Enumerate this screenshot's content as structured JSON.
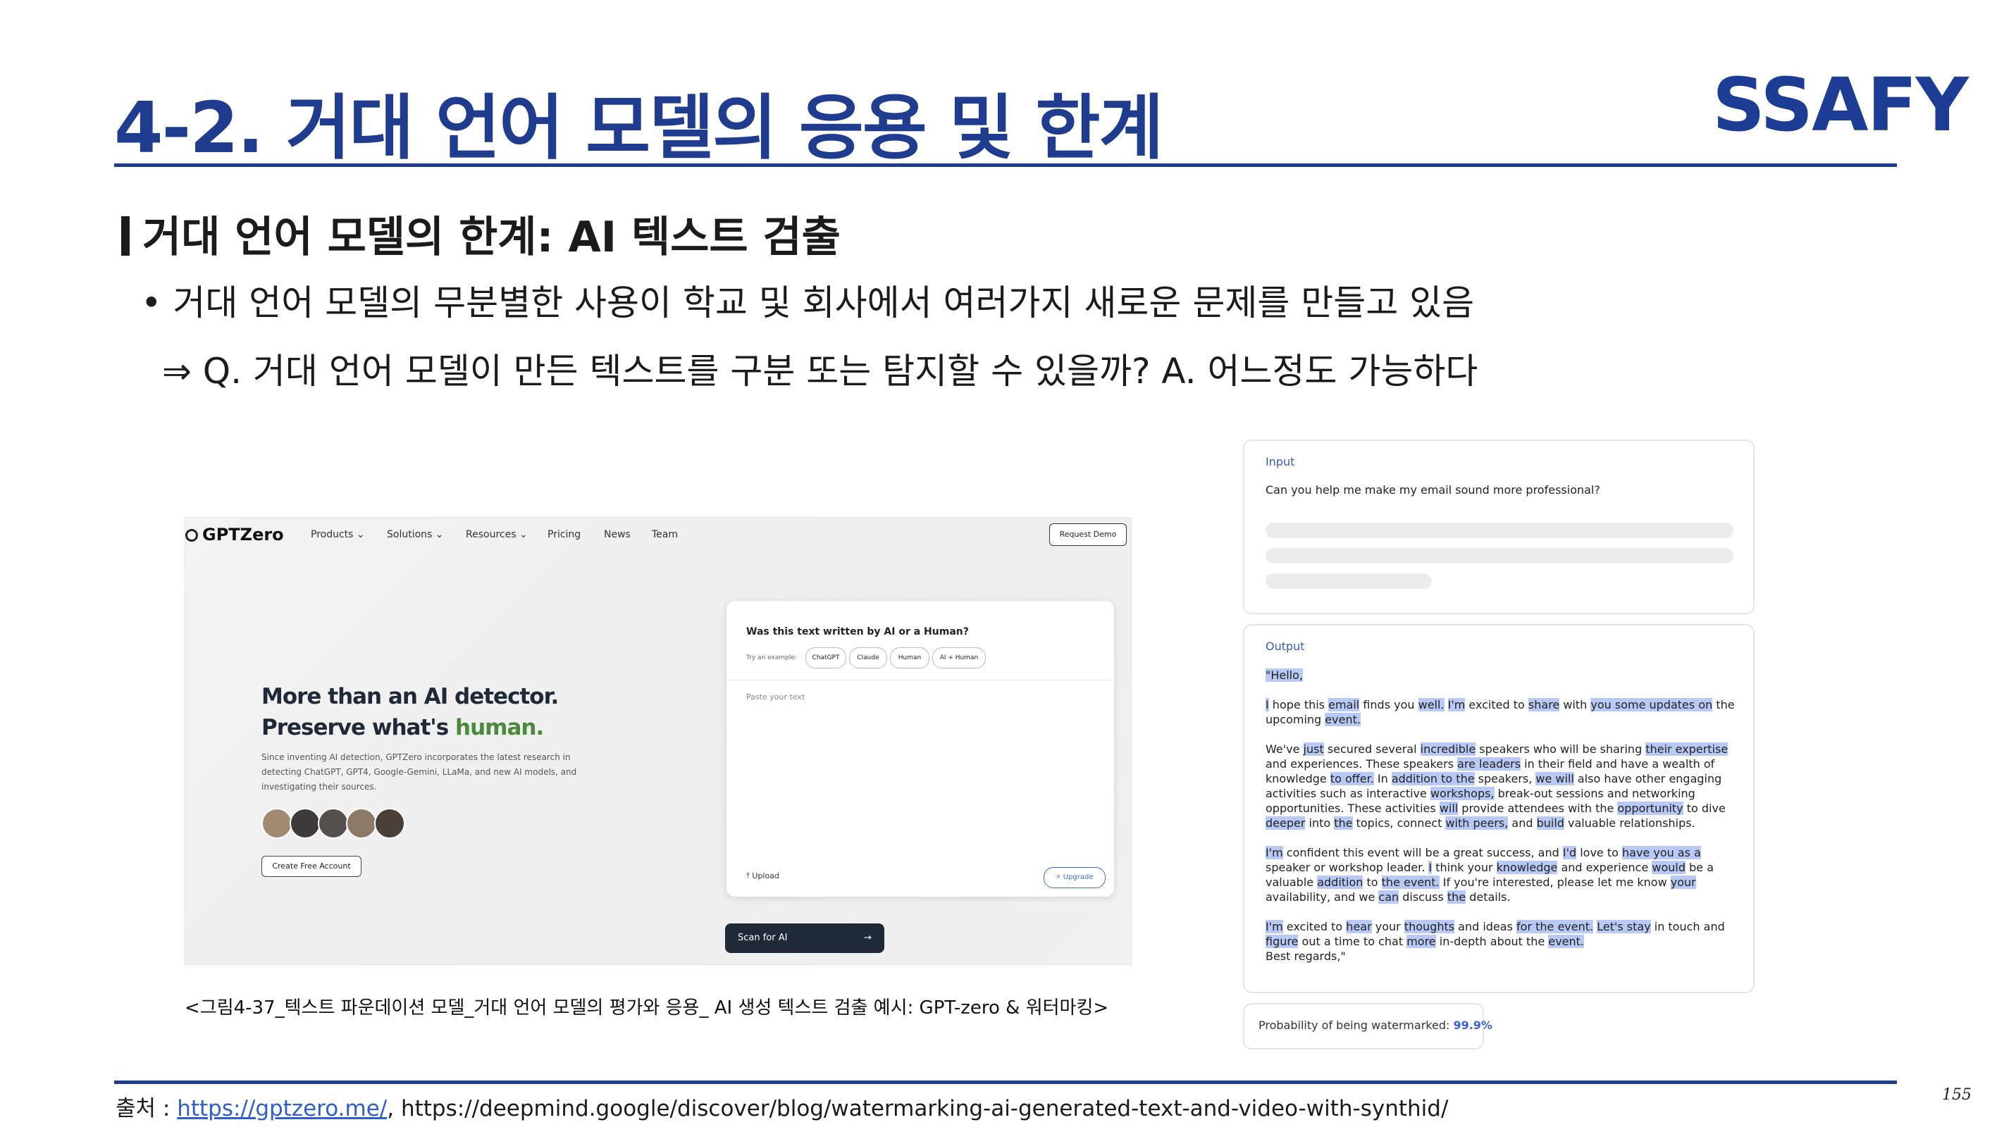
{
  "slide": {
    "title": "4-2. 거대 언어 모델의 응용 및 한계",
    "logo": "SSAFY",
    "section_heading": "거대 언어 모델의 한계: AI 텍스트 검출",
    "bullet": "• 거대 언어 모델의 무분별한 사용이 학교 및 회사에서 여러가지 새로운 문제를 만들고 있음",
    "answer": "⇒ Q. 거대 언어 모델이 만든 텍스트를 구분 또는 탐지할 수 있을까? A. 어느정도 가능하다",
    "caption": "<그림4-37_텍스트 파운데이션 모델_거대 언어 모델의 평가와 응용_ AI 생성 텍스트 검출 예시: GPT-zero & 워터마킹>",
    "source_prefix": "출처 : ",
    "source_link": "https://gptzero.me/",
    "source_rest": ", https://deepmind.google/discover/blog/watermarking-ai-generated-text-and-video-with-synthid/",
    "page_number": "155"
  },
  "gptzero": {
    "brand": "GPTZero",
    "nav": [
      "Products ⌄",
      "Solutions ⌄",
      "Resources ⌄",
      "Pricing",
      "News",
      "Team"
    ],
    "request_demo": "Request Demo",
    "headline_1": "More than an AI detector.",
    "headline_2a": "Preserve what's ",
    "headline_2b": "human.",
    "description": "Since inventing AI detection, GPTZero incorporates the latest research in detecting ChatGPT, GPT4, Google-Gemini, LLaMa, and new AI models, and investigating their sources.",
    "cta": "Create Free Account",
    "question": "Was this text written by AI or a Human?",
    "try_label": "Try an example:",
    "chips": [
      "ChatGPT",
      "Claude",
      "Human",
      "AI + Human"
    ],
    "placeholder": "Paste your text",
    "upload": "⤒ Upload",
    "upgrade": "⚡ Upgrade",
    "scan": "Scan for AI",
    "scan_arrow": "→"
  },
  "synthid": {
    "input_label": "Input",
    "input_text": "Can you help me make my email sound more professional?",
    "output_label": "Output",
    "probability_label": "Probability of being watermarked: ",
    "probability_value": "99.9%"
  },
  "colors": {
    "brand_blue": "#1f3c8e",
    "highlight": "#b8c9f5",
    "link": "#2d5ec9"
  }
}
